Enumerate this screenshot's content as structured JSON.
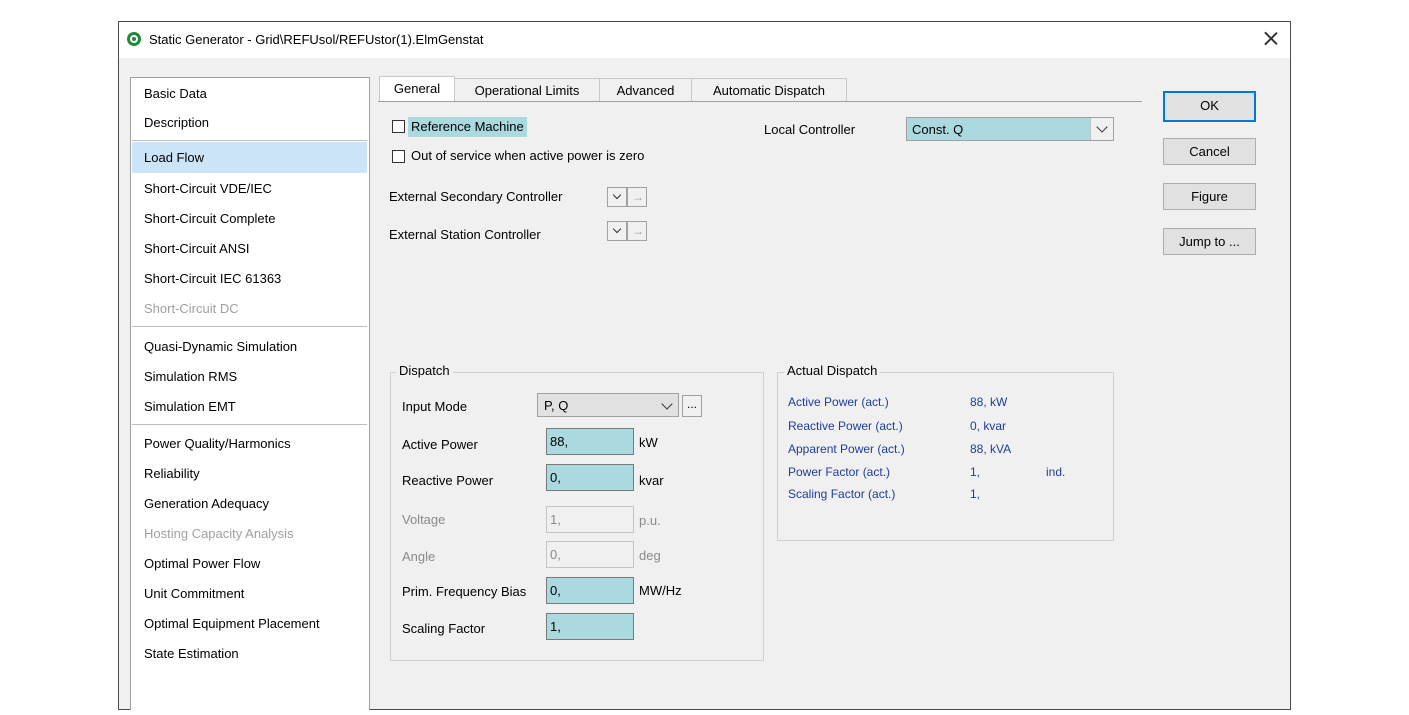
{
  "window": {
    "title": "Static Generator - Grid\\REFUsol/REFUstor(1).ElmGenstat",
    "close_label": "×"
  },
  "sidebar": {
    "items": [
      {
        "label": "Basic Data",
        "state": "normal"
      },
      {
        "label": "Description",
        "state": "normal"
      },
      {
        "label": "Load Flow",
        "state": "selected"
      },
      {
        "label": "Short-Circuit VDE/IEC",
        "state": "normal"
      },
      {
        "label": "Short-Circuit Complete",
        "state": "normal"
      },
      {
        "label": "Short-Circuit ANSI",
        "state": "normal"
      },
      {
        "label": "Short-Circuit IEC 61363",
        "state": "normal"
      },
      {
        "label": "Short-Circuit DC",
        "state": "disabled"
      },
      {
        "label": "Quasi-Dynamic Simulation",
        "state": "normal"
      },
      {
        "label": "Simulation RMS",
        "state": "normal"
      },
      {
        "label": "Simulation EMT",
        "state": "normal"
      },
      {
        "label": "Power Quality/Harmonics",
        "state": "normal"
      },
      {
        "label": "Reliability",
        "state": "normal"
      },
      {
        "label": "Generation Adequacy",
        "state": "normal"
      },
      {
        "label": "Hosting Capacity Analysis",
        "state": "disabled"
      },
      {
        "label": "Optimal Power Flow",
        "state": "normal"
      },
      {
        "label": "Unit Commitment",
        "state": "normal"
      },
      {
        "label": "Optimal Equipment Placement",
        "state": "normal"
      },
      {
        "label": "State Estimation",
        "state": "normal"
      }
    ]
  },
  "tabs": [
    {
      "label": "General",
      "active": true
    },
    {
      "label": "Operational Limits",
      "active": false
    },
    {
      "label": "Advanced",
      "active": false
    },
    {
      "label": "Automatic Dispatch",
      "active": false
    }
  ],
  "general": {
    "reference_machine_label": "Reference Machine",
    "reference_machine_checked": false,
    "out_of_service_label": "Out of service when active power is zero",
    "out_of_service_checked": false,
    "local_controller_label": "Local Controller",
    "local_controller_value": "Const. Q",
    "ext_secondary_label": "External Secondary Controller",
    "ext_station_label": "External Station Controller",
    "arrow_glyph": "→"
  },
  "dispatch": {
    "title": "Dispatch",
    "input_mode_label": "Input Mode",
    "input_mode_value": "P, Q",
    "ellipsis": "...",
    "active_power_label": "Active Power",
    "active_power_value": "88,",
    "active_power_unit": "kW",
    "reactive_power_label": "Reactive Power",
    "reactive_power_value": "0,",
    "reactive_power_unit": "kvar",
    "voltage_label": "Voltage",
    "voltage_value": "1,",
    "voltage_unit": "p.u.",
    "angle_label": "Angle",
    "angle_value": "0,",
    "angle_unit": "deg",
    "freq_bias_label": "Prim. Frequency Bias",
    "freq_bias_value": "0,",
    "freq_bias_unit": "MW/Hz",
    "scaling_label": "Scaling Factor",
    "scaling_value": "1,"
  },
  "actual_dispatch": {
    "title": "Actual Dispatch",
    "rows": [
      {
        "label": "Active Power (act.)",
        "value": "88, kW",
        "extra": ""
      },
      {
        "label": "Reactive Power (act.)",
        "value": "0, kvar",
        "extra": ""
      },
      {
        "label": "Apparent Power (act.)",
        "value": "88, kVA",
        "extra": ""
      },
      {
        "label": "Power Factor (act.)",
        "value": "1,",
        "extra": "ind."
      },
      {
        "label": "Scaling Factor (act.)",
        "value": "1,",
        "extra": ""
      }
    ]
  },
  "buttons": {
    "ok": "OK",
    "cancel": "Cancel",
    "figure": "Figure",
    "jump_to": "Jump to ..."
  },
  "colors": {
    "highlight_field": "#aad9e0",
    "selected_sidebar": "#cce4f7",
    "actual_dispatch_text": "#1f3d9a",
    "default_button_border": "#0078d7"
  }
}
